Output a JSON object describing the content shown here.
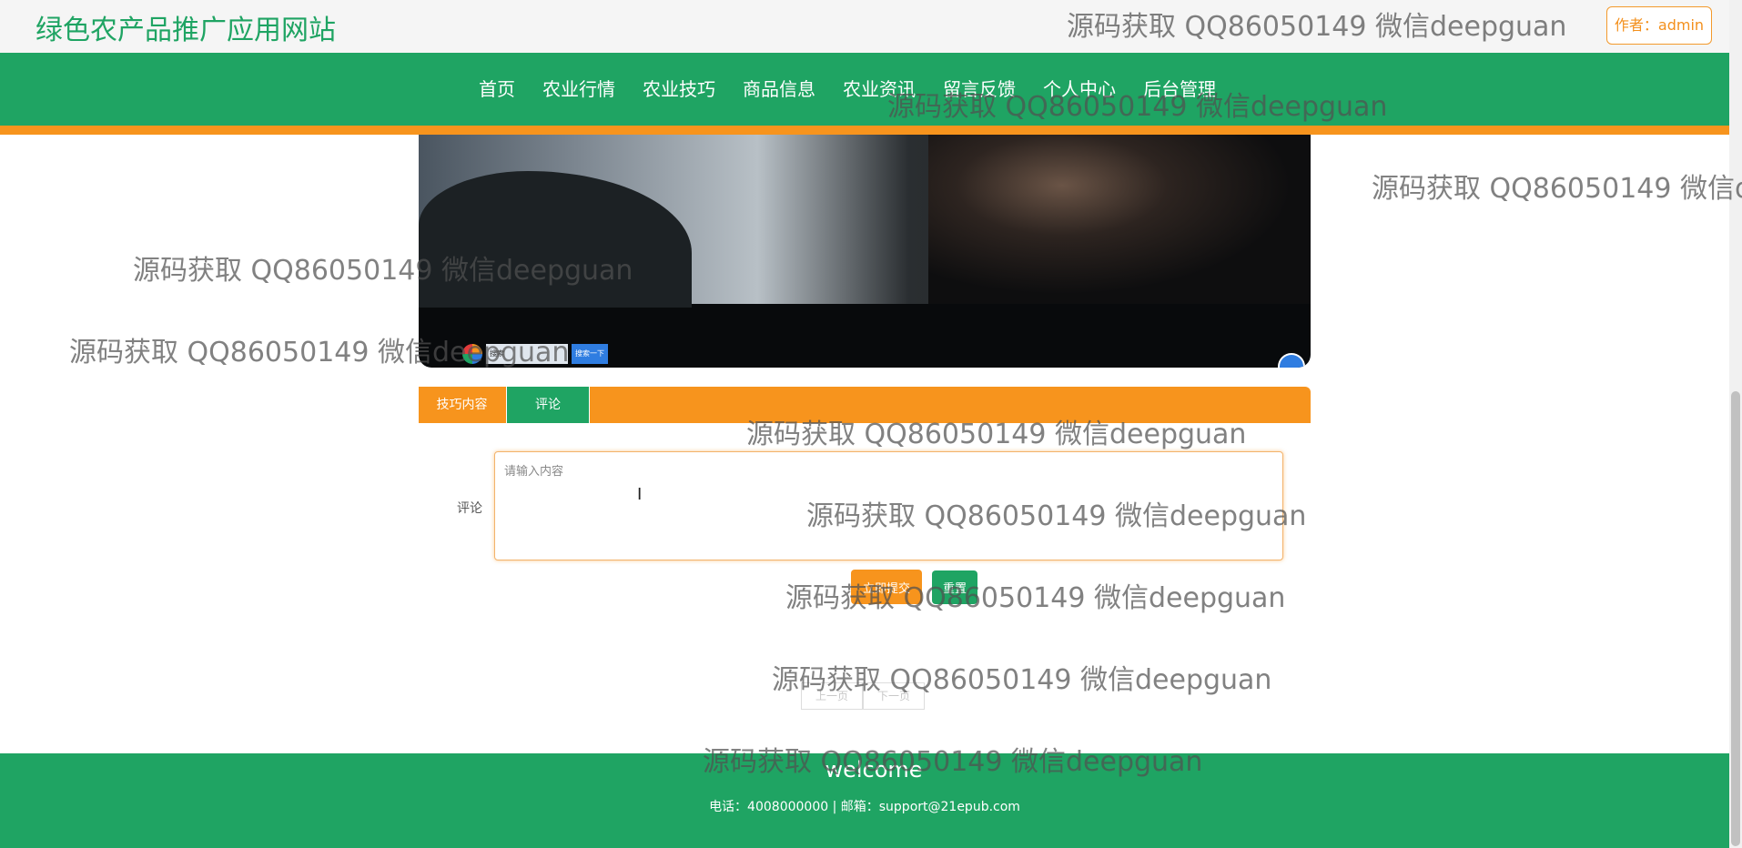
{
  "header": {
    "site_title": "绿色农产品推广应用网站",
    "author_badge": "作者：admin"
  },
  "nav": {
    "items": [
      "首页",
      "农业行情",
      "农业技巧",
      "商品信息",
      "农业资讯",
      "留言反馈",
      "个人中心",
      "后台管理"
    ]
  },
  "video": {
    "control_search_text": "搜索",
    "control_button_label": "搜索一下"
  },
  "tabs": {
    "content_label": "技巧内容",
    "comment_label": "评论"
  },
  "comment_form": {
    "label": "评论",
    "placeholder": "请输入内容",
    "submit_label": "立即提交",
    "reset_label": "重置"
  },
  "pagination": {
    "prev_label": "上一页",
    "next_label": "下一页"
  },
  "footer": {
    "welcome": "welcome",
    "contact": "电话：4008000000 | 邮箱：support@21epub.com"
  },
  "watermark_text": "源码获取 QQ86050149 微信deepguan",
  "colors": {
    "brand_green": "#1fa463",
    "accent_orange": "#f7941d"
  }
}
